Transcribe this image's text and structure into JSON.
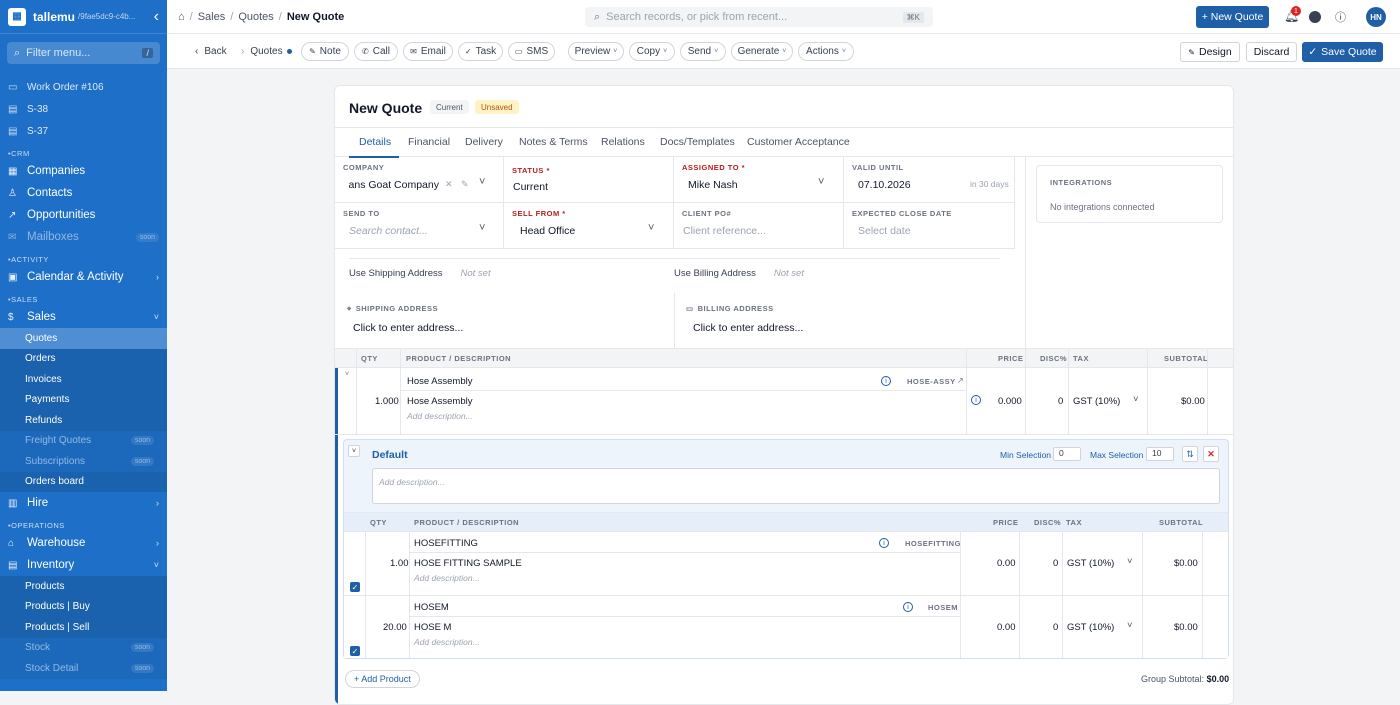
{
  "sidebar": {
    "app_name": "tallemu",
    "workspace": "/9fae5dc9-c4b...",
    "search_placeholder": "Filter menu...",
    "search_key": "/",
    "recent": [
      "Work Order #106",
      "S-38",
      "S-37"
    ],
    "sections": {
      "crm": "CRM",
      "activity": "ACTIVITY",
      "sales": "SALES",
      "operations": "OPERATIONS"
    },
    "crm_items": [
      "Companies",
      "Contacts",
      "Opportunities",
      "Mailboxes"
    ],
    "activity_items": [
      "Calendar & Activity"
    ],
    "sales_main": "Sales",
    "sales_subs": [
      "Quotes",
      "Orders",
      "Invoices",
      "Payments",
      "Refunds",
      "Freight Quotes",
      "Subscriptions",
      "Orders board"
    ],
    "hire": "Hire",
    "ops_items": [
      "Warehouse",
      "Inventory"
    ],
    "inventory_subs": [
      "Products",
      "Products | Buy",
      "Products | Sell",
      "Stock",
      "Stock Detail"
    ],
    "soon": "soon"
  },
  "topbar": {
    "breadcrumb": [
      "Sales",
      "Quotes",
      "New Quote"
    ],
    "search_placeholder": "Search records, or pick from recent...",
    "search_shortcut": "⌘K",
    "new_quote": "+ New Quote",
    "notif_count": "1",
    "avatar": "HN"
  },
  "toolbar": {
    "back": "Back",
    "quotes": "Quotes",
    "note": "Note",
    "call": "Call",
    "email": "Email",
    "task": "Task",
    "sms": "SMS",
    "preview": "Preview",
    "copy": "Copy",
    "send": "Send",
    "generate": "Generate",
    "actions": "Actions",
    "design": "Design",
    "discard": "Discard",
    "save": "Save Quote"
  },
  "quote": {
    "title": "New Quote",
    "status_pill": "Current",
    "unsaved_pill": "Unsaved",
    "tabs": [
      "Details",
      "Financial",
      "Delivery",
      "Notes & Terms",
      "Relations",
      "Docs/Templates",
      "Customer Acceptance"
    ],
    "fields": {
      "company_label": "COMPANY",
      "company_value": "Dans Goat Company",
      "status_label": "STATUS *",
      "status_value": "Current",
      "assigned_label": "ASSIGNED TO *",
      "assigned_value": "Mike Nash",
      "valid_label": "VALID UNTIL",
      "valid_value": "07.10.2026",
      "valid_hint": "in 30 days",
      "sendto_label": "SEND TO",
      "sendto_placeholder": "Search contact...",
      "sellfrom_label": "SELL FROM *",
      "sellfrom_value": "Head Office",
      "clientpo_label": "CLIENT PO#",
      "clientpo_placeholder": "Client reference...",
      "close_label": "EXPECTED CLOSE DATE",
      "close_placeholder": "Select date"
    },
    "integrations_label": "INTEGRATIONS",
    "integrations_value": "No integrations connected",
    "use_shipping": "Use Shipping Address",
    "use_billing": "Use Billing Address",
    "not_set": "Not set",
    "shipping_label": "SHIPPING ADDRESS",
    "billing_label": "BILLING ADDRESS",
    "address_placeholder": "Click to enter address...",
    "columns": {
      "qty": "QTY",
      "product": "PRODUCT / DESCRIPTION",
      "price": "PRICE",
      "disc": "DISC%",
      "tax": "TAX",
      "subtotal": "SUBTOTAL"
    },
    "main_line": {
      "name": "Hose Assembly",
      "code": "HOSE-ASSY",
      "desc": "Hose Assembly",
      "desc_placeholder": "Add description...",
      "qty": "1.000",
      "price": "0.000",
      "disc": "0",
      "tax": "GST (10%)",
      "subtotal": "$0.00"
    },
    "group": {
      "title": "Default",
      "min_label": "Min Selection",
      "min_value": "0",
      "max_label": "Max Selection",
      "max_value": "10",
      "desc_placeholder": "Add description...",
      "lines": [
        {
          "name": "HOSEFITTING",
          "code": "HOSEFITTING",
          "desc": "HOSE FITTING SAMPLE",
          "desc_placeholder": "Add description...",
          "qty": "1.00",
          "price": "0.00",
          "disc": "0",
          "tax": "GST (10%)",
          "subtotal": "$0.00"
        },
        {
          "name": "HOSEM",
          "code": "HOSEM",
          "desc": "HOSE M",
          "desc_placeholder": "Add description...",
          "qty": "20.00",
          "price": "0.00",
          "disc": "0",
          "tax": "GST (10%)",
          "subtotal": "$0.00"
        }
      ],
      "add_product": "+ Add Product",
      "subtotal_label": "Group Subtotal:",
      "subtotal_value": "$0.00"
    }
  },
  "colors": {
    "brand": "#1e6fc7",
    "primary": "#1e5fa8",
    "danger": "#dc2626",
    "warning": "#b45309"
  }
}
